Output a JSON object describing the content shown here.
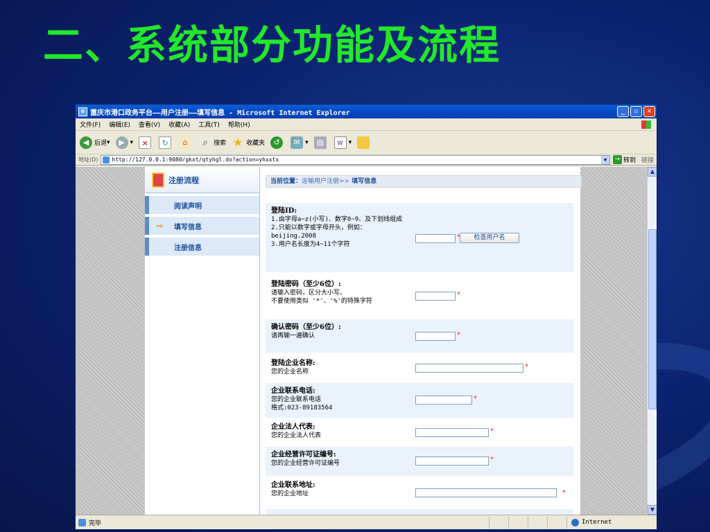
{
  "slide": {
    "title": "二、系统部分功能及流程"
  },
  "window": {
    "title": "重庆市港口政务平台——用户注册——填写信息 - Microsoft Internet Explorer",
    "controls": {
      "minimize": "_",
      "maximize": "▫",
      "close": "✕"
    }
  },
  "menu": [
    "文件(F)",
    "编辑(E)",
    "查看(V)",
    "收藏(A)",
    "工具(T)",
    "帮助(H)"
  ],
  "toolbar": {
    "back": "后退",
    "search": "搜索",
    "favorites": "收藏夹"
  },
  "address": {
    "label": "地址(D)",
    "url": "http://127.0.0.1:9080/gkxt/qtyhgl.do?action=yhxxtx",
    "go": "转到",
    "links": "链接"
  },
  "nav": {
    "header": "注册流程",
    "items": [
      {
        "label": "阅读声明",
        "current": false
      },
      {
        "label": "填写信息",
        "current": true,
        "marker": "⇒"
      },
      {
        "label": "注册信息",
        "current": false
      }
    ]
  },
  "breadcrumb": {
    "prefix": "当前位置：",
    "link": "运输用户注册>>",
    "current": " 填写信息"
  },
  "form": {
    "rows": [
      {
        "title": "登陆ID:",
        "lines": [
          "1.由字母a~z(小写)、数字0~9、及下划线组成",
          "2.只能以数字或字母开头，例如：beijing.2008",
          "3.用户名长度为4~11个字符"
        ],
        "button": "检查用户名",
        "required": "*"
      },
      {
        "title": "登陆密码（至少6位）:",
        "lines": [
          "请输入密码，区分大小写。",
          "不要使用类似 '*'、'%'的特殊字符"
        ],
        "required": "*"
      },
      {
        "title": "确认密码（至少6位）:",
        "lines": [
          "请再输一遍确认"
        ],
        "required": "*"
      },
      {
        "title": "登陆企业名称:",
        "lines": [
          "您的企业名称"
        ],
        "required": "*"
      },
      {
        "title": "企业联系电话:",
        "lines": [
          "您的企业联系电话",
          "格式:023-89183564"
        ],
        "required": "*"
      },
      {
        "title": "企业法人代表:",
        "lines": [
          "您的企业法人代表"
        ],
        "required": "*"
      },
      {
        "title": "企业经营许可证编号:",
        "lines": [
          "您的企业经营许可证编号"
        ],
        "required": "*"
      },
      {
        "title": "企业联系地址:",
        "lines": [
          "您的企业地址"
        ],
        "required": "*"
      }
    ]
  },
  "status": {
    "text": "完毕",
    "zone": "Internet"
  }
}
